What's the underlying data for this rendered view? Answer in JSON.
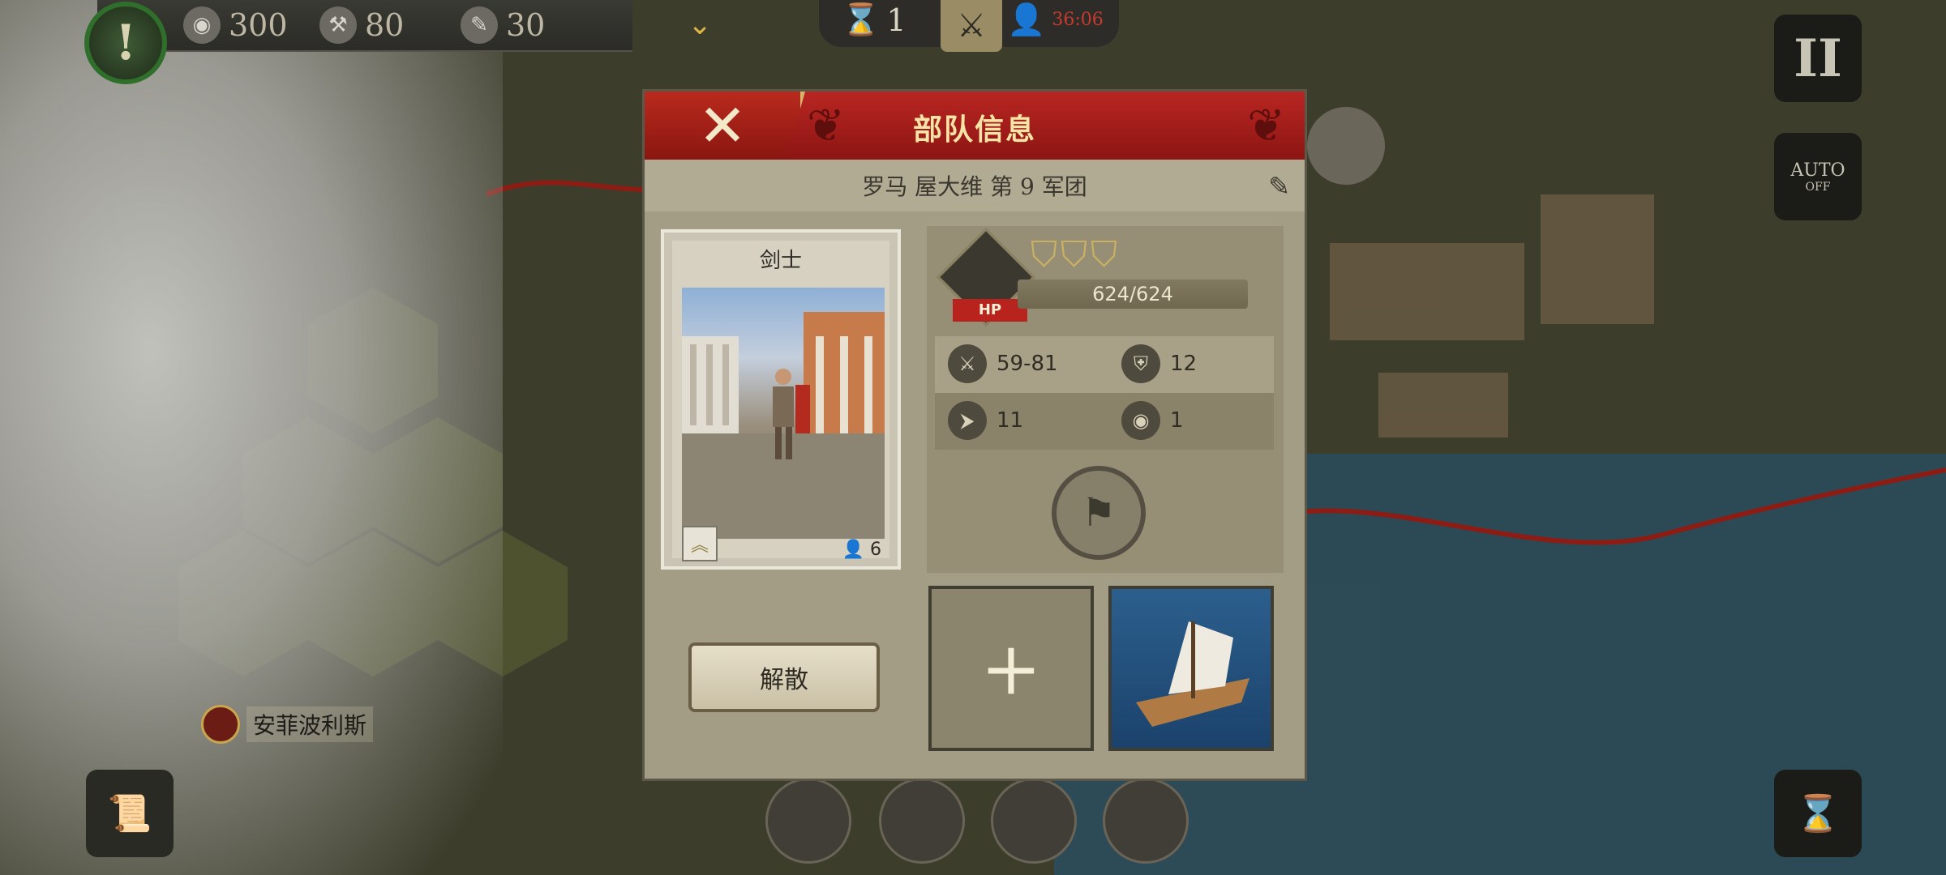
{
  "hud": {
    "alert_glyph": "!",
    "resources": [
      {
        "icon": "shield-coin-icon",
        "value": "300"
      },
      {
        "icon": "hammer-icon",
        "value": "80"
      },
      {
        "icon": "scroll-icon",
        "value": "30"
      }
    ],
    "turn": {
      "value": "1",
      "timer_text": "36:06"
    },
    "buttons": {
      "pause": "II",
      "auto_label": "AUTO",
      "auto_state": "OFF"
    }
  },
  "map": {
    "city_name": "安菲波利斯"
  },
  "dialog": {
    "title": "部队信息",
    "legion": "罗马 屋大维 第 9 军团",
    "unit": {
      "name": "剑士",
      "count": "6"
    },
    "hp": {
      "label": "HP",
      "text": "624/624"
    },
    "stats": {
      "attack": "59-81",
      "defense": "12",
      "movement": "11",
      "vision": "1"
    },
    "disband_label": "解散"
  },
  "colors": {
    "header_red": "#b82622",
    "panel_tan": "#a39d86",
    "gold": "#c9b062"
  }
}
